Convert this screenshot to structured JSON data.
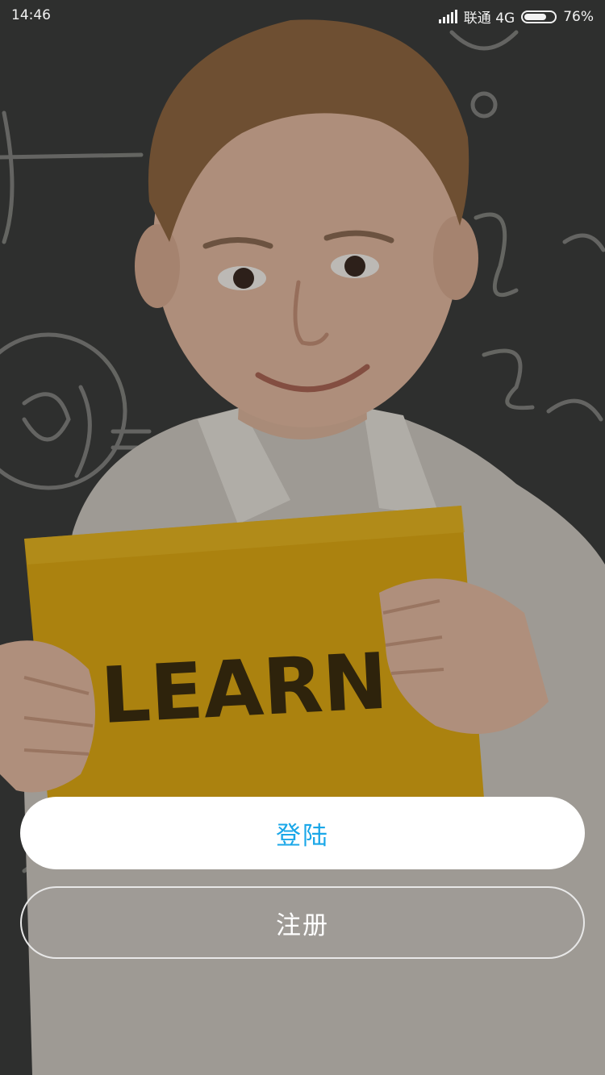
{
  "status_bar": {
    "time": "14:46",
    "carrier": "联通 4G",
    "battery_text": "76%",
    "battery_level": 0.76
  },
  "background": {
    "sign_text": "LEARN",
    "colors": {
      "chalkboard": "#3d3e3c",
      "sign": "#e0ad16",
      "shirt": "#cfcac2"
    }
  },
  "actions": {
    "login_label": "登陆",
    "register_label": "注册"
  },
  "colors": {
    "accent": "#1aa7e8"
  }
}
